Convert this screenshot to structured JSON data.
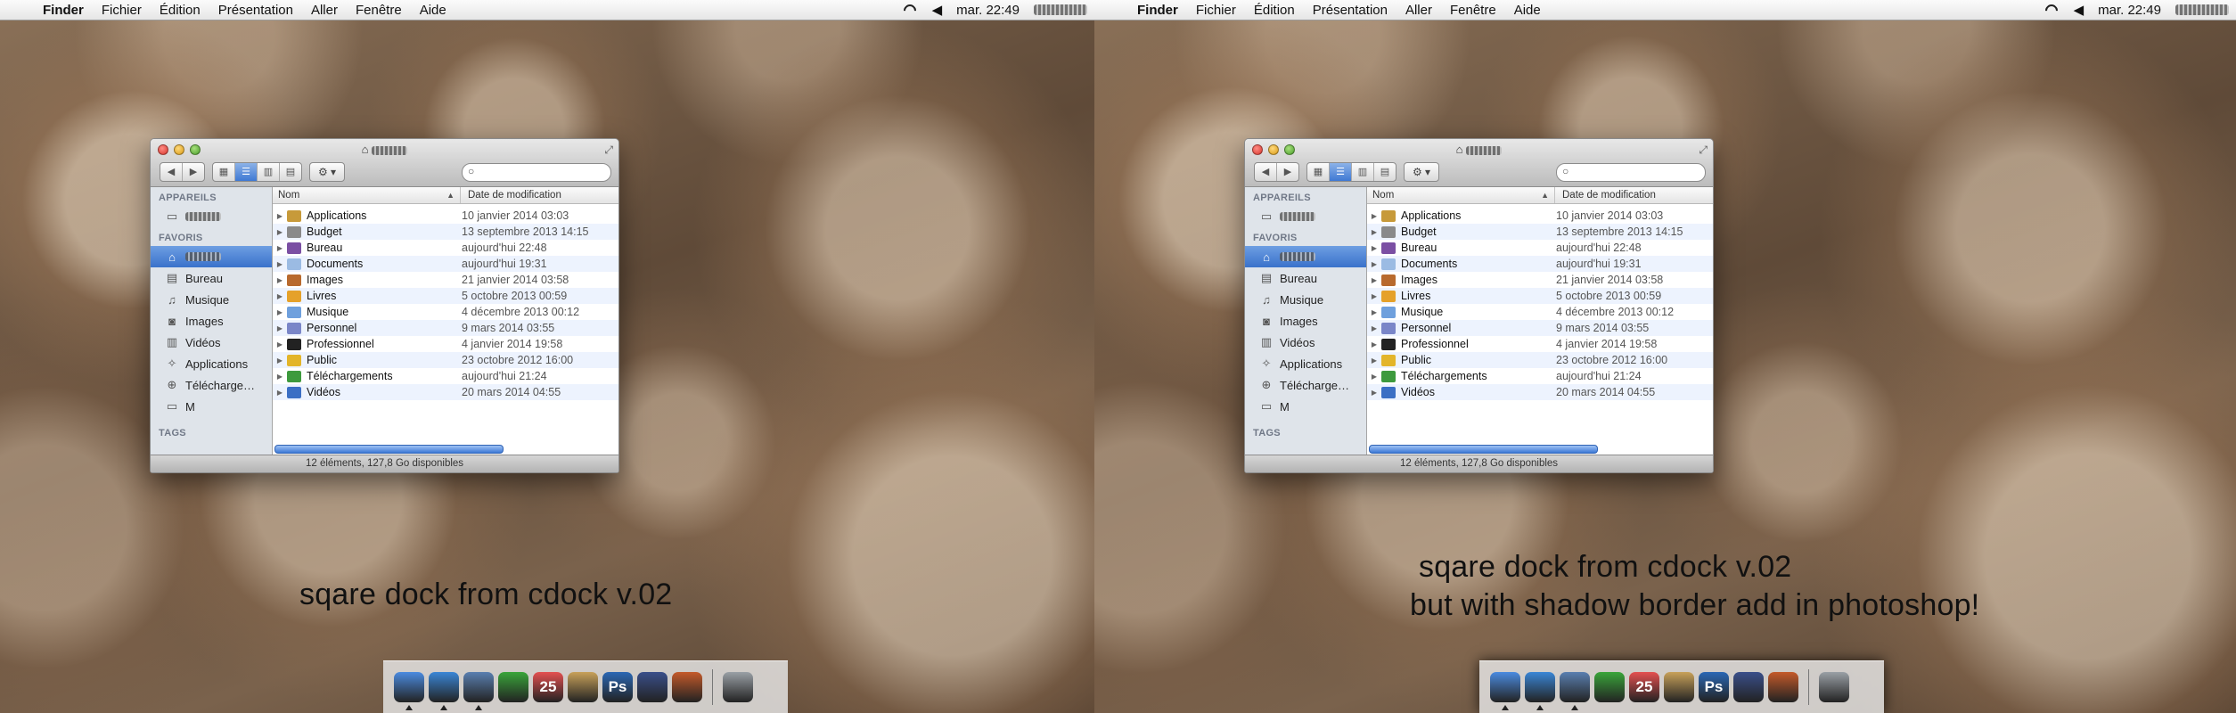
{
  "menubar": {
    "app": "Finder",
    "menus": [
      "Fichier",
      "Édition",
      "Présentation",
      "Aller",
      "Fenêtre",
      "Aide"
    ],
    "clock": "mar. 22:49"
  },
  "finder": {
    "sidebar": {
      "devices_header": "APPAREILS",
      "favorites_header": "FAVORIS",
      "tags_header": "TAGS",
      "favorites": [
        "Bureau",
        "Musique",
        "Images",
        "Vidéos",
        "Applications",
        "Télécharge…",
        "M"
      ]
    },
    "columns": {
      "name": "Nom",
      "date": "Date de modification"
    },
    "rows": [
      {
        "name": "Applications",
        "date": "10 janvier 2014 03:03",
        "color": "#c79a3a"
      },
      {
        "name": "Budget",
        "date": "13 septembre 2013 14:15",
        "color": "#8a8a8a"
      },
      {
        "name": "Bureau",
        "date": "aujourd'hui 22:48",
        "color": "#7b4fa3"
      },
      {
        "name": "Documents",
        "date": "aujourd'hui 19:31",
        "color": "#9bbbe3"
      },
      {
        "name": "Images",
        "date": "21 janvier 2014 03:58",
        "color": "#b86a2e"
      },
      {
        "name": "Livres",
        "date": "5 octobre 2013 00:59",
        "color": "#e5a12a"
      },
      {
        "name": "Musique",
        "date": "4 décembre 2013 00:12",
        "color": "#6fa0dd"
      },
      {
        "name": "Personnel",
        "date": "9 mars 2014 03:55",
        "color": "#7a86c8"
      },
      {
        "name": "Professionnel",
        "date": "4 janvier 2014 19:58",
        "color": "#222222"
      },
      {
        "name": "Public",
        "date": "23 octobre 2012 16:00",
        "color": "#e3b52a"
      },
      {
        "name": "Téléchargements",
        "date": "aujourd'hui 21:24",
        "color": "#3d9a3d"
      },
      {
        "name": "Vidéos",
        "date": "20 mars 2014 04:55",
        "color": "#3b6fc4"
      }
    ],
    "status": "12 éléments, 127,8 Go disponibles"
  },
  "captions": {
    "left": "sqare dock from cdock v.02",
    "right_line1": "sqare dock from cdock v.02",
    "right_line2": "but with shadow border add in photoshop!"
  },
  "dock": {
    "items": [
      {
        "name": "finder",
        "color": "#4b8be0",
        "label": ""
      },
      {
        "name": "safari",
        "color": "#3a86d6",
        "label": ""
      },
      {
        "name": "preview",
        "color": "#5a7fb0",
        "label": ""
      },
      {
        "name": "itunes",
        "color": "#3aa53a",
        "label": ""
      },
      {
        "name": "calendar",
        "color": "#e45050",
        "label": "25"
      },
      {
        "name": "notes",
        "color": "#c8a15a",
        "label": ""
      },
      {
        "name": "photoshop",
        "color": "#2b67b4",
        "label": "Ps"
      },
      {
        "name": "imovie",
        "color": "#3a4f8a",
        "label": ""
      },
      {
        "name": "photo-booth",
        "color": "#c45a2a",
        "label": ""
      },
      {
        "name": "trash",
        "color": "#9aa0a6",
        "label": ""
      }
    ]
  }
}
